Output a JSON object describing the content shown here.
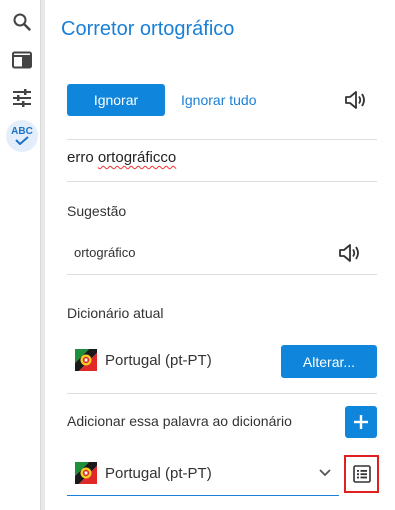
{
  "toolbar": {
    "items": [
      {
        "name": "search-icon"
      },
      {
        "name": "panel-icon"
      },
      {
        "name": "sliders-icon"
      },
      {
        "name": "spellcheck-icon",
        "label": "ABC",
        "active": true
      }
    ]
  },
  "panel": {
    "title": "Corretor ortográfico",
    "ignore_label": "Ignorar",
    "ignore_all_label": "Ignorar tudo",
    "error_prefix": "erro ",
    "error_word": "ortográficco",
    "suggestion_heading": "Sugestão",
    "suggestion": "ortográfico",
    "current_dictionary_heading": "Dicionário atual",
    "current_dictionary": "Portugal (pt-PT)",
    "change_label": "Alterar...",
    "add_word_heading": "Adicionar essa palavra ao dicionário",
    "add_dictionary_selected": "Portugal (pt-PT)"
  },
  "colors": {
    "accent": "#0f86db",
    "title": "#1a7fd6",
    "highlight": "#e02020"
  }
}
